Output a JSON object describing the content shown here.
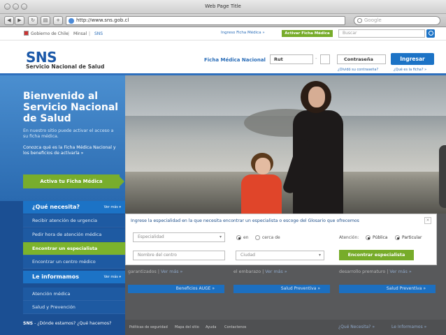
{
  "browser": {
    "window_title": "Web Page Title",
    "nav_back": "◀",
    "nav_forward": "▶",
    "nav_reload": "↻",
    "nav_bookmarks": "▤",
    "nav_add": "+",
    "url": "http://www.sns.gob.cl",
    "search_placeholder": "Google"
  },
  "govbar": {
    "links": [
      "Gobierno de Chile",
      "Minsal",
      "SNS"
    ],
    "ingreso_ficha": "Ingreso Ficha Médica »",
    "activar_ficha": "Activar Ficha Médica",
    "search_placeholder": "Buscar"
  },
  "header": {
    "logo": "SNS",
    "logo_subtitle": "Servicio Nacional de Salud",
    "ficha_label": "Ficha Médica Nacional",
    "rut_placeholder": "Rut",
    "rut_dash": "-",
    "password_placeholder": "Contraseña",
    "login_button": "Ingresar",
    "forgot_password": "¿Olvidó su contraseña?",
    "what_is_ficha": "¿Qué es la ficha? »"
  },
  "sidebar": {
    "welcome_title": "Bienvenido al Servicio Nacional de Salud",
    "intro_text": "En nuestro sitio puede activar el acceso a su ficha médica.",
    "ficha_text": "Conozca qué es la Ficha Médica Nacional y los beneficios de activarla »",
    "activate_button": "Activa tu Ficha Médica",
    "que_necesita": {
      "title": "¿Qué necesita?",
      "ver_mas": "Ver más ▾",
      "items": [
        "Recibir atención de urgencia",
        "Pedir hora de atención médica",
        "Encontrar un especialista",
        "Encontrar un centro médico"
      ]
    },
    "le_informamos": {
      "title": "Le informamos",
      "ver_mas": "Ver más ▾",
      "items": [
        "Atención médica",
        "Salud y Prevención"
      ]
    },
    "footer_logo": "SNS",
    "footer_text": "- ¿Dónde estamos? ¿Qué hacemos?"
  },
  "search_panel": {
    "title": "Ingrese la especialidad en la que necesita encontrar un especialista o escoge del Glosario que ofrecemos",
    "close": "×",
    "especialidad_placeholder": "Especialidad",
    "en_label": "en",
    "cerca_label": "cerca de",
    "atencion_label": "Atención:",
    "publica_label": "Pública",
    "particular_label": "Particular",
    "centro_placeholder": "Nombre del centro",
    "ciudad_placeholder": "Ciudad",
    "arrow": "▾",
    "submit_button": "Encontrar especialista"
  },
  "columns": [
    {
      "text": "garantizados",
      "ver_mas": "Ver más »",
      "button": "Beneficios AUGE »"
    },
    {
      "text": "el embarazo",
      "ver_mas": "Ver más »",
      "button": "Salud Preventiva »"
    },
    {
      "text": "desarrollo prematuro",
      "ver_mas": "Ver más »",
      "button": "Salud Preventiva »"
    }
  ],
  "footer": {
    "links": [
      "Políticas de seguridad",
      "Mapa del sitio",
      "Ayuda",
      "Contactenos"
    ],
    "que_necesita": "¿Qué Necesita? »",
    "le_informamos": "Le Informamos »"
  }
}
